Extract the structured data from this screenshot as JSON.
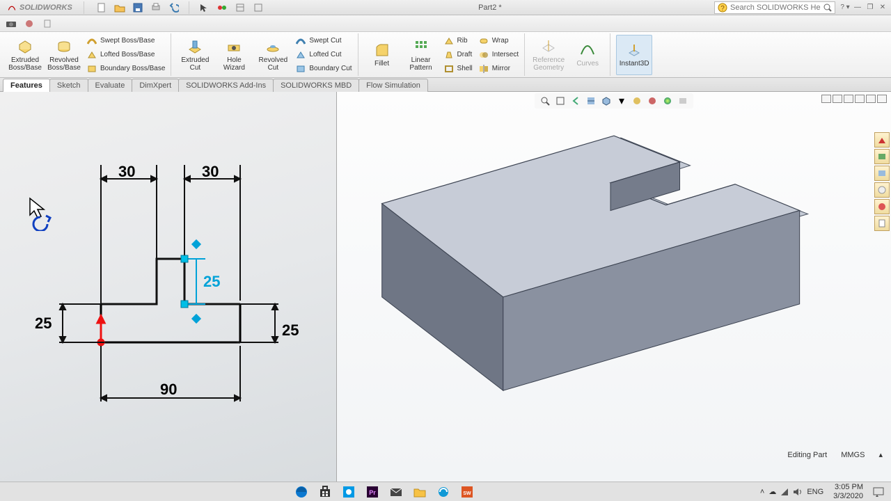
{
  "app": {
    "name": "SOLIDWORKS",
    "doc_title": "Part2 *"
  },
  "search": {
    "placeholder": "Search SOLIDWORKS Help"
  },
  "ribbon": {
    "extruded_boss": "Extruded Boss/Base",
    "revolved_boss": "Revolved Boss/Base",
    "swept_boss": "Swept Boss/Base",
    "lofted_boss": "Lofted Boss/Base",
    "boundary_boss": "Boundary Boss/Base",
    "extruded_cut": "Extruded Cut",
    "hole_wizard": "Hole Wizard",
    "revolved_cut": "Revolved Cut",
    "swept_cut": "Swept Cut",
    "lofted_cut": "Lofted Cut",
    "boundary_cut": "Boundary Cut",
    "fillet": "Fillet",
    "linear_pattern": "Linear Pattern",
    "rib": "Rib",
    "draft": "Draft",
    "shell": "Shell",
    "wrap": "Wrap",
    "intersect": "Intersect",
    "mirror": "Mirror",
    "ref_geometry": "Reference Geometry",
    "curves": "Curves",
    "instant3d": "Instant3D"
  },
  "tabs": {
    "features": "Features",
    "sketch": "Sketch",
    "evaluate": "Evaluate",
    "dimxpert": "DimXpert",
    "addins": "SOLIDWORKS Add-Ins",
    "mbd": "SOLIDWORKS MBD",
    "flow": "Flow Simulation"
  },
  "sketch_dims": {
    "top_left": "30",
    "top_right": "30",
    "mid_selected": "25",
    "left": "25",
    "right": "25",
    "bottom": "90"
  },
  "status": {
    "mode": "Editing Part",
    "units": "MMGS",
    "lang": "ENG",
    "time": "3:05 PM",
    "date": "3/3/2020"
  }
}
